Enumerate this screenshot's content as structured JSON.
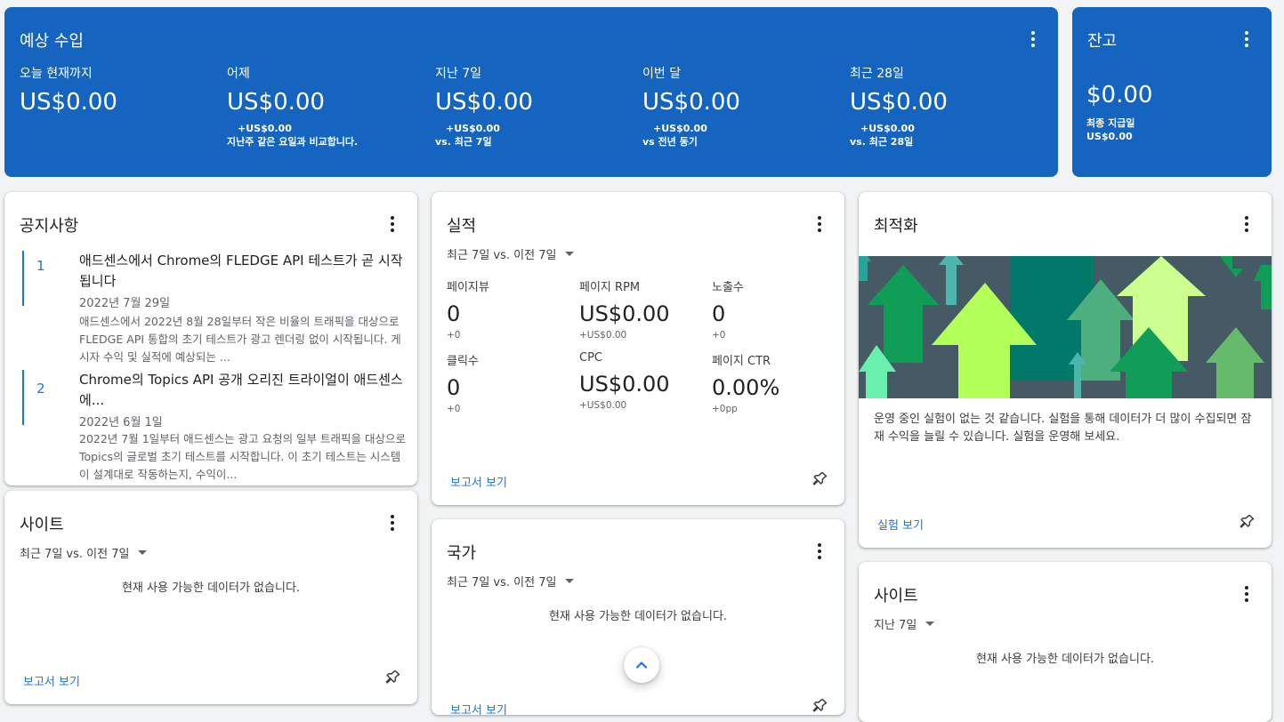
{
  "earnings": {
    "title": "예상 수입",
    "metrics": [
      {
        "label": "오늘 현재까지",
        "value": "US$0.00",
        "delta": "",
        "compare": ""
      },
      {
        "label": "어제",
        "value": "US$0.00",
        "delta": "+US$0.00",
        "compare": "지난주 같은 요일과 비교합니다."
      },
      {
        "label": "지난 7일",
        "value": "US$0.00",
        "delta": "+US$0.00",
        "compare": "vs. 최근 7일"
      },
      {
        "label": "이번 달",
        "value": "US$0.00",
        "delta": "+US$0.00",
        "compare": "vs 전년 동기"
      },
      {
        "label": "최근 28일",
        "value": "US$0.00",
        "delta": "+US$0.00",
        "compare": "vs. 최근 28일"
      }
    ]
  },
  "balance": {
    "title": "잔고",
    "value": "$0.00",
    "last_payment_label": "최종 지급일",
    "last_payment_value": "US$0.00"
  },
  "notices": {
    "title": "공지사항",
    "items": [
      {
        "num": "1",
        "title": "애드센스에서 Chrome의 FLEDGE API 테스트가 곧 시작됩니다",
        "date": "2022년 7월 29일",
        "body": "애드센스에서 2022년 8월 28일부터 작은 비율의 트래픽을 대상으로 FLEDGE API 통합의 초기 테스트가 광고 렌더링 없이 시작됩니다. 게시자 수익 및 실적에 예상되는 ..."
      },
      {
        "num": "2",
        "title": "Chrome의 Topics API 공개 오리진 트라이얼이 애드센스에...",
        "date": "2022년 6월 1일",
        "body": "2022년 7월 1일부터 애드센스는 광고 요청의 일부 트래픽을 대상으로 Topics의 글로벌 초기 테스트를 시작합니다. 이 초기 테스트는 시스템이 설계대로 작동하는지, 수익이..."
      }
    ]
  },
  "performance": {
    "title": "실적",
    "range": "최근 7일 vs. 이전 7일",
    "metrics": [
      {
        "label": "페이지뷰",
        "value": "0",
        "delta": "+0"
      },
      {
        "label": "페이지 RPM",
        "value": "US$0.00",
        "delta": "+US$0.00"
      },
      {
        "label": "노출수",
        "value": "0",
        "delta": "+0"
      },
      {
        "label": "클릭수",
        "value": "0",
        "delta": "+0"
      },
      {
        "label": "CPC",
        "value": "US$0.00",
        "delta": "+US$0.00"
      },
      {
        "label": "페이지 CTR",
        "value": "0.00%",
        "delta": "+0pp"
      }
    ],
    "link": "보고서 보기"
  },
  "optimization": {
    "title": "최적화",
    "text": "운영 중인 실험이 없는 것 같습니다. 실험을 통해 데이터가 더 많이 수집되면 잠재 수익을 늘릴 수 있습니다. 실험을 운영해 보세요.",
    "link": "실험 보기"
  },
  "sites_left": {
    "title": "사이트",
    "range": "최근 7일 vs. 이전 7일",
    "empty": "현재 사용 가능한 데이터가 없습니다.",
    "link": "보고서 보기"
  },
  "countries": {
    "title": "국가",
    "range": "최근 7일 vs. 이전 7일",
    "empty": "현재 사용 가능한 데이터가 없습니다.",
    "link": "보고서 보기"
  },
  "sites_right": {
    "title": "사이트",
    "range": "지난 7일",
    "empty": "현재 사용 가능한 데이터가 없습니다."
  },
  "colors": {
    "brand_blue": "#1565c0",
    "link_blue": "#1a73e8"
  }
}
